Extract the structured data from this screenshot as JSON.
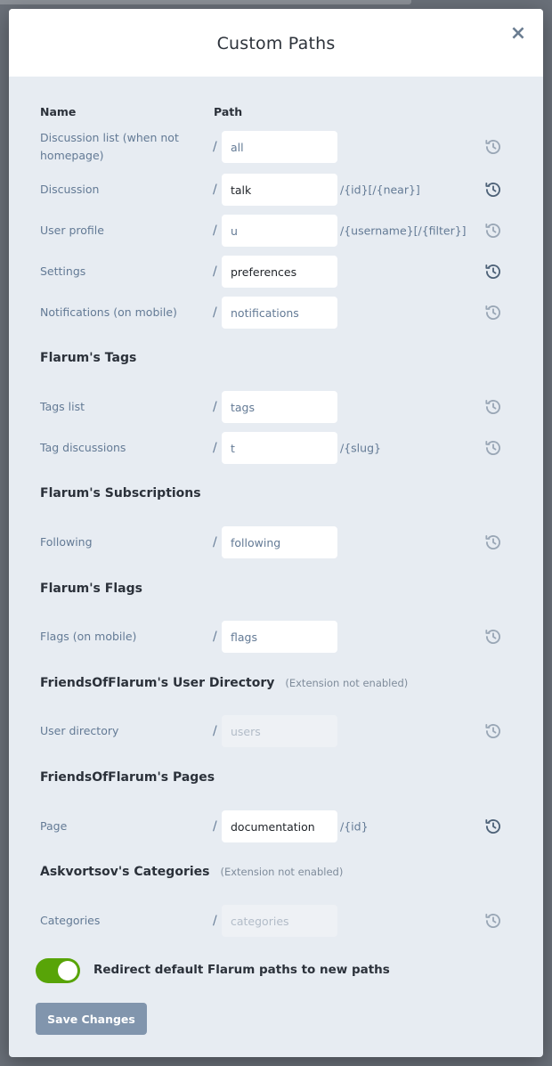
{
  "modal": {
    "title": "Custom Paths",
    "close_label": "×"
  },
  "columns": {
    "name": "Name",
    "path": "Path"
  },
  "slash": "/",
  "core_rows": [
    {
      "label": "Discussion list (when not homepage)",
      "value": "all",
      "custom": false,
      "suffix": "",
      "reset_active": false
    },
    {
      "label": "Discussion",
      "value": "talk",
      "custom": true,
      "suffix": "/{id}[/{near}]",
      "reset_active": true
    },
    {
      "label": "User profile",
      "value": "u",
      "custom": false,
      "suffix": "/{username}[/{filter}]",
      "reset_active": false
    },
    {
      "label": "Settings",
      "value": "preferences",
      "custom": true,
      "suffix": "",
      "reset_active": true
    },
    {
      "label": "Notifications (on mobile)",
      "value": "notifications",
      "custom": false,
      "suffix": "",
      "reset_active": false
    }
  ],
  "sections": [
    {
      "title": "Flarum's Tags",
      "note": "",
      "rows": [
        {
          "label": "Tags list",
          "value": "tags",
          "custom": false,
          "suffix": "",
          "reset_active": false
        },
        {
          "label": "Tag discussions",
          "value": "t",
          "custom": false,
          "suffix": "/{slug}",
          "reset_active": false
        }
      ]
    },
    {
      "title": "Flarum's Subscriptions",
      "note": "",
      "rows": [
        {
          "label": "Following",
          "value": "following",
          "custom": false,
          "suffix": "",
          "reset_active": false
        }
      ]
    },
    {
      "title": "Flarum's Flags",
      "note": "",
      "rows": [
        {
          "label": "Flags (on mobile)",
          "value": "flags",
          "custom": false,
          "suffix": "",
          "reset_active": false
        }
      ]
    },
    {
      "title": "FriendsOfFlarum's User Directory",
      "note": "(Extension not enabled)",
      "rows": [
        {
          "label": "User directory",
          "value": "",
          "placeholder": "users",
          "disabled": true,
          "custom": false,
          "suffix": "",
          "reset_active": false
        }
      ]
    },
    {
      "title": "FriendsOfFlarum's Pages",
      "note": "",
      "rows": [
        {
          "label": "Page",
          "value": "documentation",
          "custom": true,
          "suffix": "/{id}",
          "reset_active": true
        }
      ]
    },
    {
      "title": "Askvortsov's Categories",
      "note": "(Extension not enabled)",
      "rows": [
        {
          "label": "Categories",
          "value": "",
          "placeholder": "categories",
          "disabled": true,
          "custom": false,
          "suffix": "",
          "reset_active": false
        }
      ]
    }
  ],
  "redirect_toggle": {
    "label": "Redirect default Flarum paths to new paths",
    "on": true,
    "color": "#58a408"
  },
  "save_button": {
    "label": "Save Changes",
    "color": "#8195ad"
  },
  "icons": {
    "reset": "history-icon",
    "close": "close-icon"
  }
}
